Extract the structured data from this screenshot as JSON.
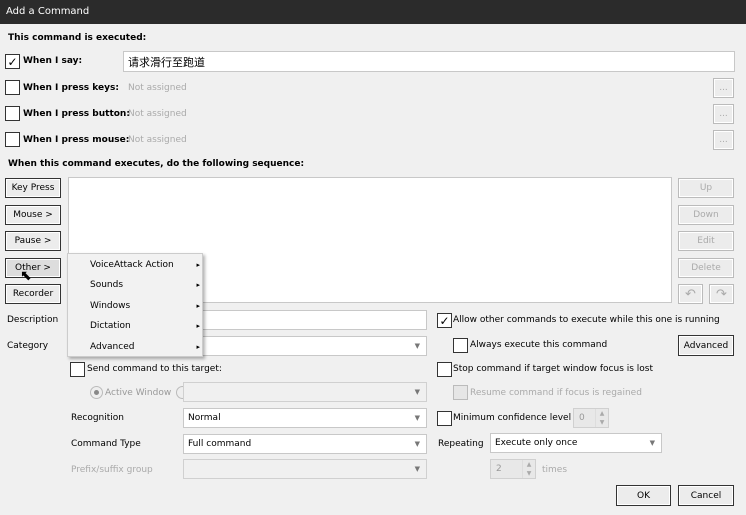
{
  "window": {
    "title": "Add a Command"
  },
  "triggers": {
    "heading": "This command is executed:",
    "say": {
      "label": "When I say:",
      "checked": true,
      "value": "请求滑行至跑道"
    },
    "keys": {
      "label": "When I press keys:",
      "value": "Not assigned"
    },
    "button": {
      "label": "When I press button:",
      "value": "Not assigned"
    },
    "mouse": {
      "label": "When I press mouse:",
      "value": "Not assigned"
    },
    "more": "..."
  },
  "sequence": {
    "heading": "When this command executes, do the following sequence:",
    "left_buttons": [
      "Key Press",
      "Mouse >",
      "Pause >",
      "Other >",
      "Recorder"
    ],
    "right_buttons": [
      "Up",
      "Down",
      "Edit",
      "Delete"
    ],
    "undo_icon": "undo-icon",
    "redo_icon": "redo-icon"
  },
  "other_menu": {
    "items": [
      "VoiceAttack Action",
      "Sounds",
      "Windows",
      "Dictation",
      "Advanced"
    ],
    "arrow": "▸"
  },
  "form": {
    "description_label": "Description",
    "description_value": "",
    "category_label": "Category",
    "category_value": "",
    "send_label": "Send command to this target:",
    "active_window": "Active Window",
    "recognition_label": "Recognition",
    "recognition_value": "Normal",
    "command_type_label": "Command Type",
    "command_type_value": "Full command",
    "prefix_label": "Prefix/suffix group",
    "prefix_value": ""
  },
  "options": {
    "allow": "Allow other commands to execute while this one is running",
    "always": "Always execute this command",
    "advanced_button": "Advanced",
    "stop": "Stop command if target window focus is lost",
    "resume": "Resume command if focus is regained",
    "min_conf": "Minimum confidence level",
    "min_conf_value": "0",
    "repeating_label": "Repeating",
    "repeating_value": "Execute only once",
    "times_value": "2",
    "times_label": "times"
  },
  "footer": {
    "ok": "OK",
    "cancel": "Cancel"
  },
  "check": "✓"
}
